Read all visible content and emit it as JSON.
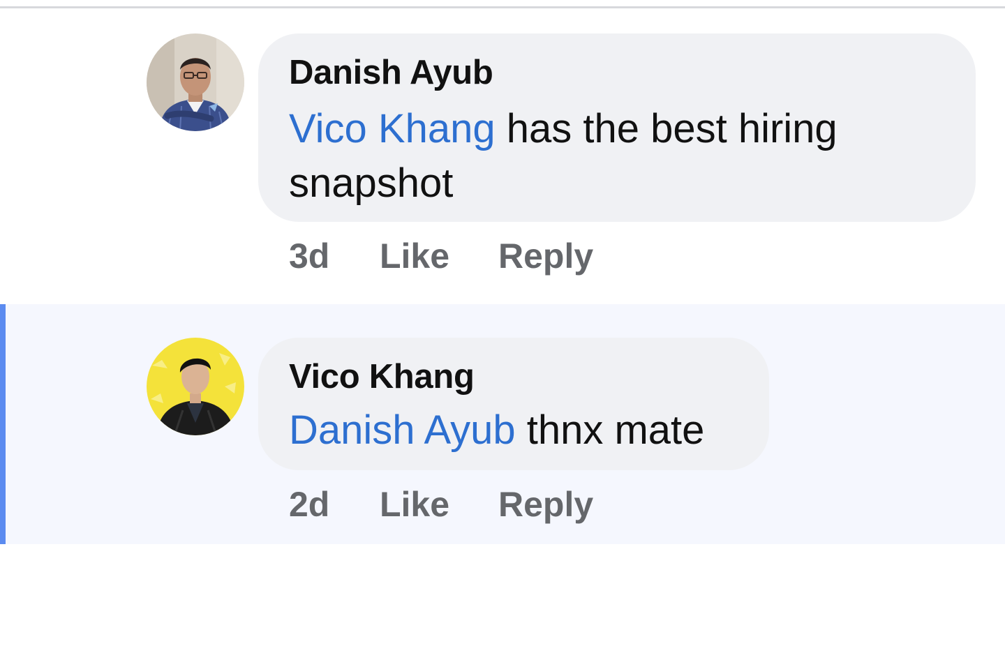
{
  "comments": [
    {
      "author": "Danish Ayub",
      "mention": "Vico Khang",
      "text": " has the best hiring snapshot",
      "time": "3d",
      "like_label": "Like",
      "reply_label": "Reply",
      "highlighted": false
    },
    {
      "author": "Vico Khang",
      "mention": "Danish Ayub",
      "text": " thnx mate",
      "time": "2d",
      "like_label": "Like",
      "reply_label": "Reply",
      "highlighted": true
    }
  ],
  "colors": {
    "mention": "#2d6fd0",
    "bubble": "#f0f1f4",
    "action_text": "#65676b",
    "highlight_bar": "#5b8bf0",
    "highlight_background": "#f5f7fe"
  }
}
